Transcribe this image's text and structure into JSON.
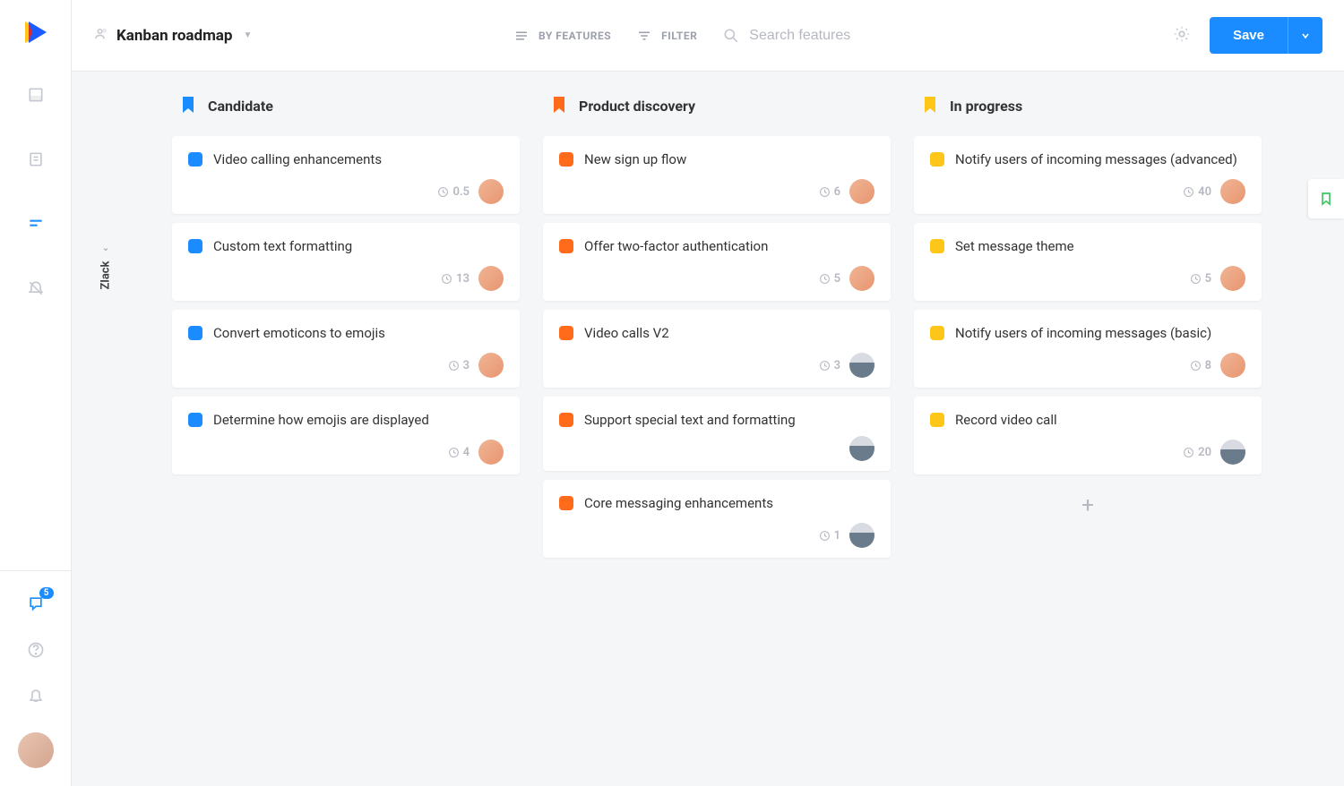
{
  "header": {
    "title": "Kanban roadmap",
    "by_features_label": "BY FEATURES",
    "filter_label": "FILTER",
    "search_placeholder": "Search features",
    "save_label": "Save"
  },
  "left_rail": {
    "inbox_badge": "5"
  },
  "project": {
    "name": "Zlack"
  },
  "columns": [
    {
      "title": "Candidate",
      "color": "#1a8cff",
      "cards": [
        {
          "title": "Video calling enhancements",
          "estimate": "0.5",
          "avatar": "female"
        },
        {
          "title": "Custom text formatting",
          "estimate": "13",
          "avatar": "female"
        },
        {
          "title": "Convert emoticons to emojis",
          "estimate": "3",
          "avatar": "female"
        },
        {
          "title": "Determine how emojis are displayed",
          "estimate": "4",
          "avatar": "female"
        }
      ]
    },
    {
      "title": "Product discovery",
      "color": "#ff6b1a",
      "cards": [
        {
          "title": "New sign up flow",
          "estimate": "6",
          "avatar": "female"
        },
        {
          "title": "Offer two-factor authentication",
          "estimate": "5",
          "avatar": "female"
        },
        {
          "title": "Video calls V2",
          "estimate": "3",
          "avatar": "male"
        },
        {
          "title": "Support special text and formatting",
          "estimate": "",
          "avatar": "male"
        },
        {
          "title": "Core messaging enhancements",
          "estimate": "1",
          "avatar": "male"
        }
      ]
    },
    {
      "title": "In progress",
      "color": "#ffc61a",
      "cards": [
        {
          "title": "Notify users of incoming messages (advanced)",
          "estimate": "40",
          "avatar": "female"
        },
        {
          "title": "Set message theme",
          "estimate": "5",
          "avatar": "female"
        },
        {
          "title": "Notify users of incoming messages (basic)",
          "estimate": "8",
          "avatar": "female"
        },
        {
          "title": "Record video call",
          "estimate": "20",
          "avatar": "male"
        }
      ]
    }
  ]
}
